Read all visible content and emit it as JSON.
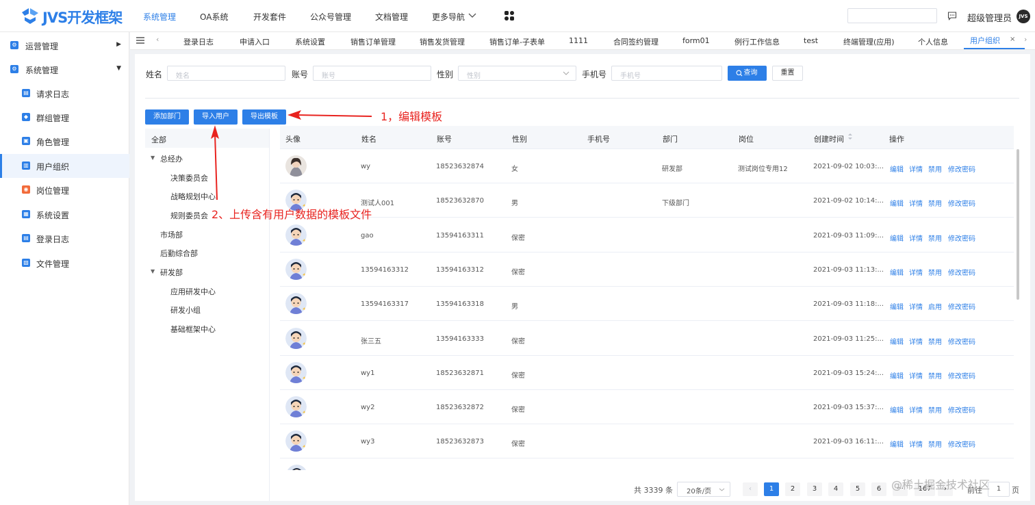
{
  "app": {
    "logo_text": "JVS开发框架",
    "brand_color": "#2d7fe7"
  },
  "topnav": [
    "系统管理",
    "OA系统",
    "开发套件",
    "公众号管理",
    "文档管理",
    "更多导航"
  ],
  "header": {
    "username": "超级管理员",
    "avatar_text": "JVS"
  },
  "sidebar": {
    "groups": [
      {
        "label": "运营管理"
      },
      {
        "label": "系统管理"
      }
    ],
    "items": [
      {
        "label": "请求日志"
      },
      {
        "label": "群组管理"
      },
      {
        "label": "角色管理"
      },
      {
        "label": "用户组织"
      },
      {
        "label": "岗位管理"
      },
      {
        "label": "系统设置"
      },
      {
        "label": "登录日志"
      },
      {
        "label": "文件管理"
      }
    ]
  },
  "tabs": [
    "登录日志",
    "申请入口",
    "系统设置",
    "销售订单管理",
    "销售发货管理",
    "销售订单-子表单",
    "1111",
    "合同签约管理",
    "form01",
    "例行工作信息",
    "test",
    "终端管理(应用)",
    "个人信息",
    "用户组织"
  ],
  "filters": {
    "name_label": "姓名",
    "name_placeholder": "姓名",
    "account_label": "账号",
    "account_placeholder": "账号",
    "gender_label": "性别",
    "gender_placeholder": "性别",
    "phone_label": "手机号",
    "phone_placeholder": "手机号",
    "search_button": "查询",
    "reset_button": "重置"
  },
  "toolbar": {
    "add_dept": "添加部门",
    "import_users": "导入用户",
    "export_template": "导出模板"
  },
  "annotations": {
    "step1": "1，编辑模板",
    "step2": "2、上传含有用户数据的模板文件"
  },
  "tree": {
    "all": "全部",
    "nodes": [
      "总经办",
      "决策委员会",
      "战略规划中心",
      "规则委员会",
      "市场部",
      "后勤综合部",
      "研发部",
      "应用研发中心",
      "研发小组",
      "基础框架中心"
    ]
  },
  "table": {
    "headers": [
      "头像",
      "姓名",
      "账号",
      "性别",
      "手机号",
      "部门",
      "岗位",
      "创建时间",
      "操作"
    ],
    "rows": [
      {
        "name": "wy",
        "account": "18523632874",
        "gender": "女",
        "phone": "",
        "dept": "研发部",
        "post": "测试岗位专用12",
        "created": "2021-09-02 10:03:...",
        "toggle": "禁用"
      },
      {
        "name": "测试人001",
        "account": "18523632870",
        "gender": "男",
        "phone": "",
        "dept": "下级部门",
        "post": "",
        "created": "2021-09-02 10:14:...",
        "toggle": "禁用"
      },
      {
        "name": "gao",
        "account": "13594163311",
        "gender": "保密",
        "phone": "",
        "dept": "",
        "post": "",
        "created": "2021-09-03 11:09:...",
        "toggle": "禁用"
      },
      {
        "name": "13594163312",
        "account": "13594163312",
        "gender": "保密",
        "phone": "",
        "dept": "",
        "post": "",
        "created": "2021-09-03 11:13:...",
        "toggle": "禁用"
      },
      {
        "name": "13594163317",
        "account": "13594163318",
        "gender": "男",
        "phone": "",
        "dept": "",
        "post": "",
        "created": "2021-09-03 11:18:...",
        "toggle": "启用"
      },
      {
        "name": "张三五",
        "account": "13594163333",
        "gender": "保密",
        "phone": "",
        "dept": "",
        "post": "",
        "created": "2021-09-03 11:25:...",
        "toggle": "禁用"
      },
      {
        "name": "wy1",
        "account": "18523632871",
        "gender": "保密",
        "phone": "",
        "dept": "",
        "post": "",
        "created": "2021-09-03 15:24:...",
        "toggle": "禁用"
      },
      {
        "name": "wy2",
        "account": "18523632872",
        "gender": "保密",
        "phone": "",
        "dept": "",
        "post": "",
        "created": "2021-09-03 15:37:...",
        "toggle": "禁用"
      },
      {
        "name": "wy3",
        "account": "18523632873",
        "gender": "保密",
        "phone": "",
        "dept": "",
        "post": "",
        "created": "2021-09-03 16:11:...",
        "toggle": "禁用"
      }
    ],
    "actions": {
      "edit": "编辑",
      "detail": "详情",
      "change_password": "修改密码"
    }
  },
  "pagination": {
    "total": "共 3339 条",
    "page_size": "20条/页",
    "pages": [
      "1",
      "2",
      "3",
      "4",
      "5",
      "6"
    ],
    "last_page": "167",
    "goto_label": "前往",
    "goto_value": "1",
    "goto_suffix": "页"
  },
  "watermark": "@稀土掘金技术社区"
}
